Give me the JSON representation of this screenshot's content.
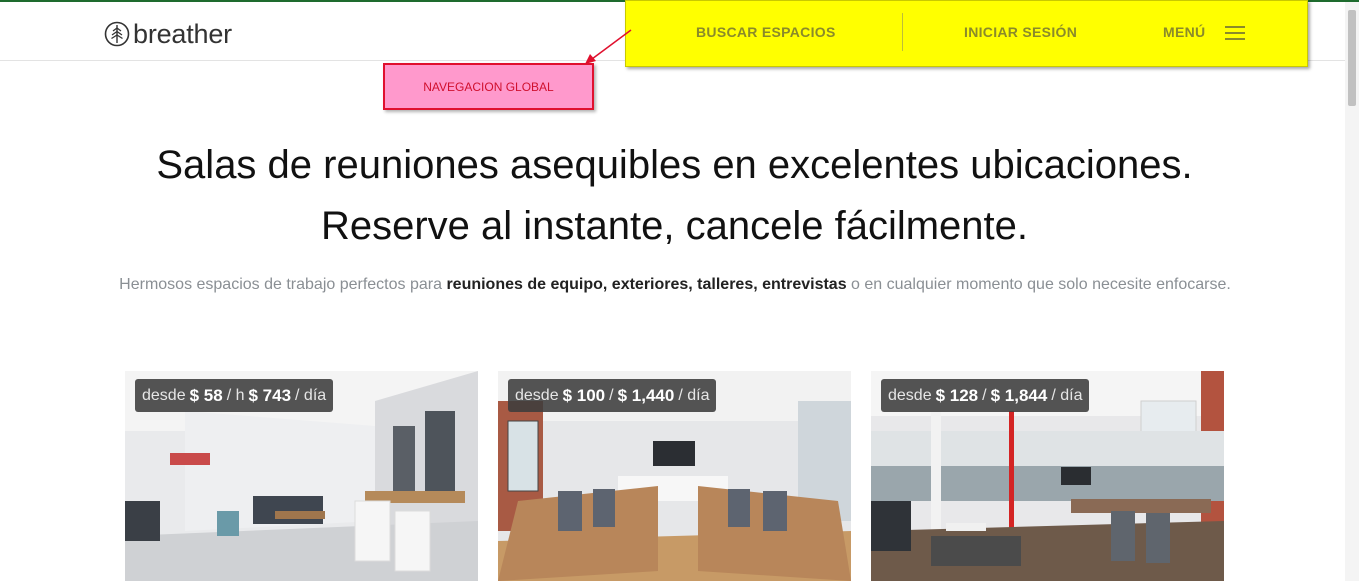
{
  "logo": {
    "text": "breather"
  },
  "nav": {
    "search_label": "BUSCAR ESPACIOS",
    "login_label": "INICIAR SESIÓN",
    "menu_label": "MENÚ",
    "highlight_color": "#ffff00"
  },
  "annotation": {
    "label": "NAVEGACION GLOBAL",
    "color": "#ff99cc"
  },
  "hero": {
    "line1": "Salas de reuniones asequibles en excelentes ubicaciones.",
    "line2": "Reserve al instante, cancele fácilmente."
  },
  "subtitle": {
    "before": "Hermosos espacios de trabajo perfectos para ",
    "bold": "reuniones de equipo, exteriores, talleres, entrevistas",
    "after": " o en cualquier momento que solo necesite enfocarse."
  },
  "cards": [
    {
      "from": "desde",
      "hour_price": "$ 58",
      "hour_unit": "/ h",
      "day_price": "$ 743",
      "day_unit": "/ día"
    },
    {
      "from": "desde",
      "hour_price": "$ 100",
      "hour_unit": "/",
      "day_price": "$ 1,440",
      "day_unit": "/ día"
    },
    {
      "from": "desde",
      "hour_price": "$ 128",
      "hour_unit": "/",
      "day_price": "$ 1,844",
      "day_unit": "/ día"
    }
  ]
}
